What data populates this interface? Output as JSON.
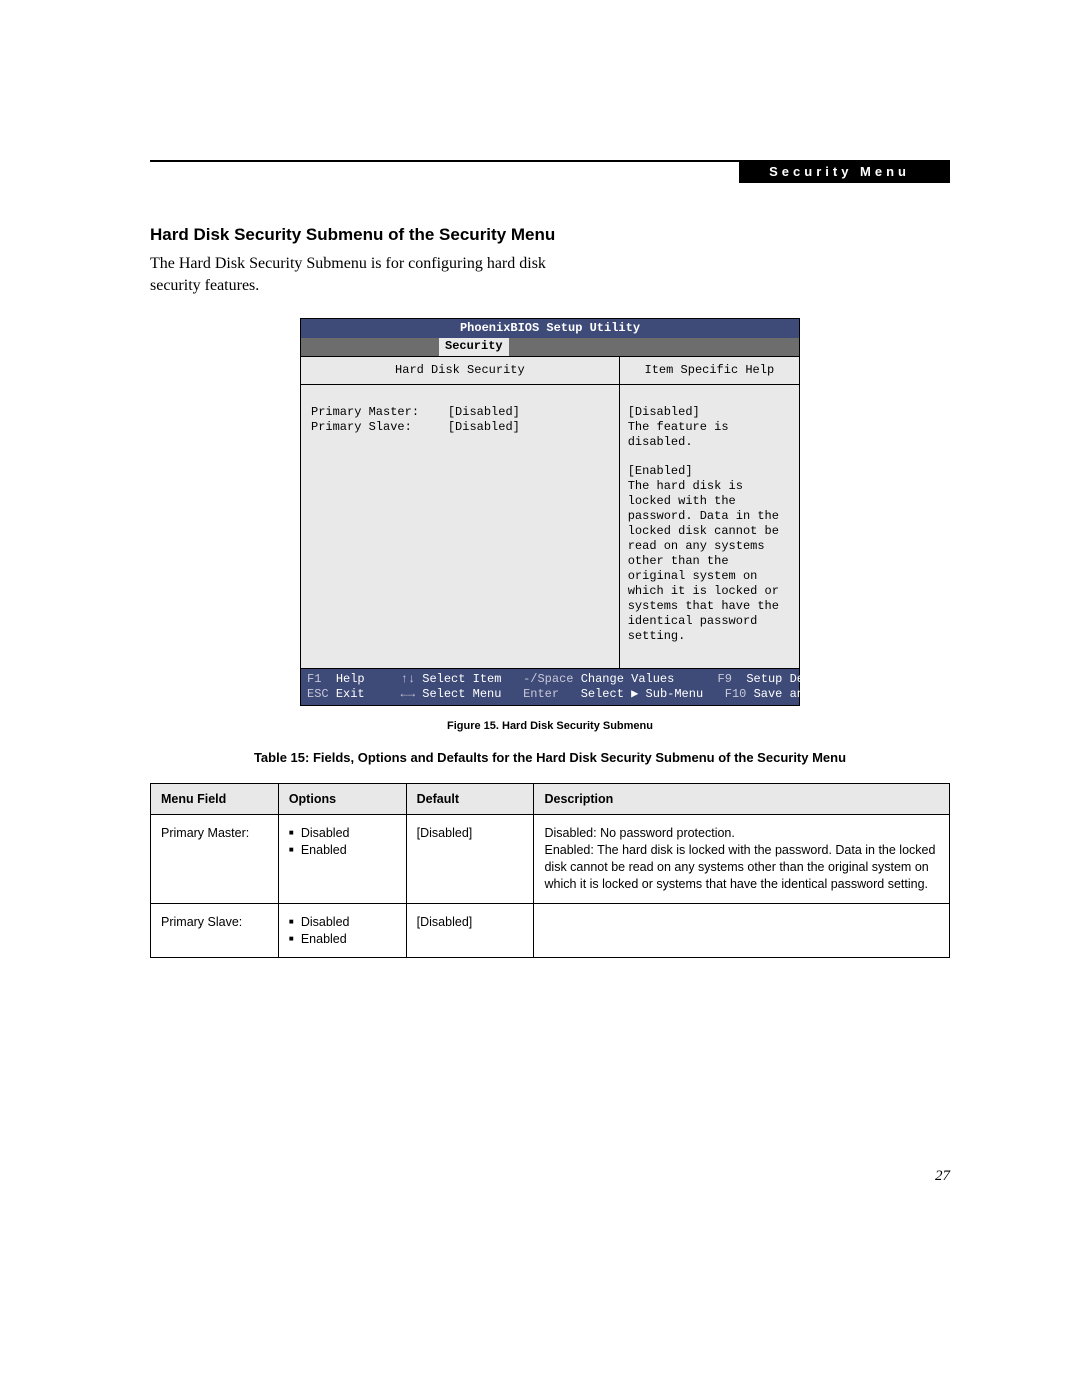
{
  "chapter_label": "Security Menu",
  "section_title": "Hard Disk Security Submenu of the Security Menu",
  "intro_text": "The Hard Disk Security Submenu is for configuring hard disk security features.",
  "bios": {
    "title": "PhoenixBIOS Setup Utility",
    "active_tab": "Security",
    "left_header": "Hard Disk Security",
    "right_header": "Item Specific Help",
    "fields": [
      {
        "label": "Primary Master:",
        "value": "[Disabled]"
      },
      {
        "label": "Primary Slave:",
        "value": "[Disabled]"
      }
    ],
    "help": {
      "disabled_label": "[Disabled]",
      "disabled_text": "The feature is disabled.",
      "enabled_label": "[Enabled]",
      "enabled_text": "The hard disk is locked with the password. Data in the locked disk cannot be read on any systems other than the original system on which it is locked or systems that have the identical password setting."
    },
    "footer": {
      "l1_k1": "F1",
      "l1_t1": "Help",
      "l1_k2": "↑↓",
      "l1_t2": "Select Item",
      "l1_k3": "-/Space",
      "l1_t3": "Change Values",
      "l1_k4": "F9",
      "l1_t4": "Setup Defaults",
      "l2_k1": "ESC",
      "l2_t1": "Exit",
      "l2_k2": "←→",
      "l2_t2": "Select Menu",
      "l2_k3": "Enter",
      "l2_t3": "Select ▶ Sub-Menu",
      "l2_k4": "F10",
      "l2_t4": "Save and Exit"
    }
  },
  "figure_caption": "Figure 15.  Hard Disk Security Submenu",
  "table_caption": "Table 15: Fields, Options and Defaults for the Hard Disk Security Submenu of the Security Menu",
  "table": {
    "headers": {
      "h1": "Menu Field",
      "h2": "Options",
      "h3": "Default",
      "h4": "Description"
    },
    "rows": [
      {
        "field": "Primary Master:",
        "options": [
          "Disabled",
          "Enabled"
        ],
        "default": "[Disabled]",
        "description": "Disabled: No password protection.\nEnabled: The hard disk is locked with the password. Data in the locked disk cannot be read on any systems other than the original system on which it is locked or systems that have the identical password setting."
      },
      {
        "field": "Primary Slave:",
        "options": [
          "Disabled",
          "Enabled"
        ],
        "default": "[Disabled]",
        "description": ""
      }
    ]
  },
  "page_number": "27"
}
